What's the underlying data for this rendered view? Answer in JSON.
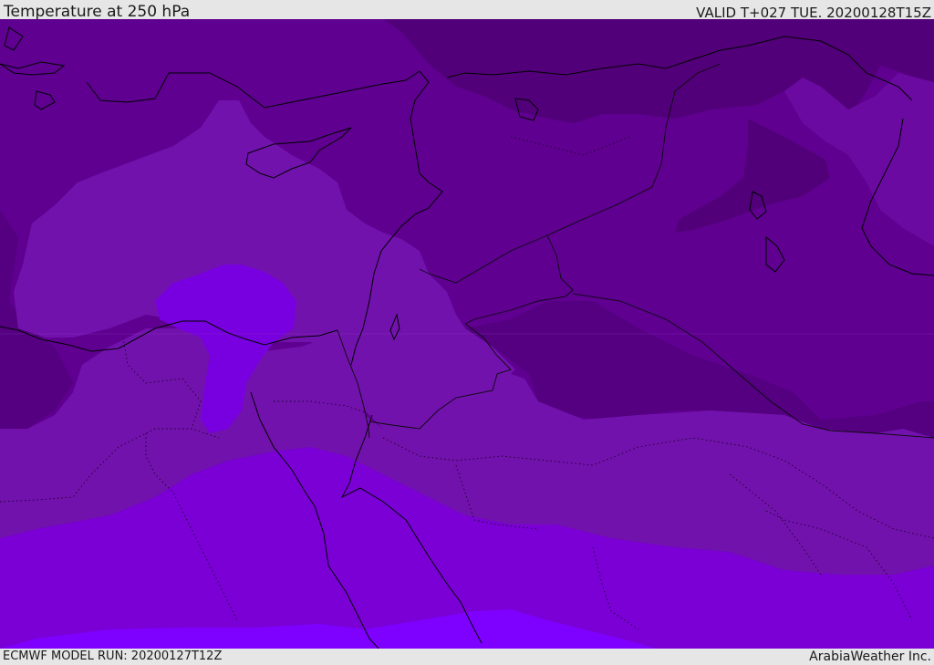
{
  "header": {
    "title": "Temperature at 250 hPa",
    "valid": "VALID T+027 TUE. 20200128T15Z"
  },
  "footer": {
    "model_run": "ECMWF MODEL RUN: 20200127T12Z",
    "credit": "ArabiaWeather Inc."
  },
  "map": {
    "variable": "temperature",
    "level_hpa": 250,
    "colors": {
      "coldest": "#4f0075",
      "cold": "#5f0090",
      "medium": "#7212ad",
      "warm": "#7a00d6",
      "warmest": "#7c00ff",
      "coastline": "#000000",
      "border": "#111111"
    }
  }
}
